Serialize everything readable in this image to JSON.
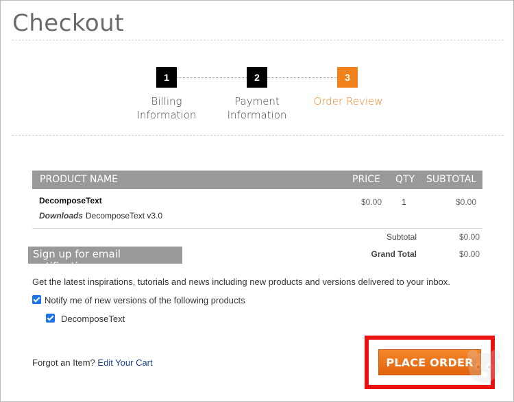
{
  "page": {
    "title": "Checkout"
  },
  "steps": [
    {
      "number": "1",
      "label_line1": "Billing",
      "label_line2": "Information",
      "color": "#000000"
    },
    {
      "number": "2",
      "label_line1": "Payment",
      "label_line2": "Information",
      "color": "#000000"
    },
    {
      "number": "3",
      "label_line1": "Order Review",
      "label_line2": "",
      "color": "#f0811b"
    }
  ],
  "table": {
    "headers": {
      "product": "PRODUCT NAME",
      "price": "PRICE",
      "qty": "QTY",
      "subtotal": "SUBTOTAL"
    },
    "rows": [
      {
        "name": "DecomposeText",
        "option_label": "Downloads",
        "option_value": "DecomposeText v3.0",
        "price": "$0.00",
        "qty": "1",
        "subtotal": "$0.00"
      }
    ]
  },
  "totals": {
    "subtotal_label": "Subtotal",
    "subtotal_value": "$0.00",
    "grand_total_label": "Grand Total",
    "grand_total_value": "$0.00"
  },
  "email": {
    "banner": "Sign up for email notifications",
    "description": "Get the latest inspirations, tutorials and news including new products and versions delivered to your inbox.",
    "notify_label": "Notify me of new versions of the following products",
    "notify_checked": true,
    "products": [
      {
        "label": "DecomposeText",
        "checked": true
      }
    ]
  },
  "footer": {
    "forgot_text": "Forgot an Item?",
    "edit_cart_link": "Edit Your Cart",
    "place_order_label": "PLACE ORDER"
  },
  "colors": {
    "accent": "#f0811b",
    "highlight": "#e81212",
    "header_bg": "#999999",
    "checkbox": "#1a73e8"
  }
}
